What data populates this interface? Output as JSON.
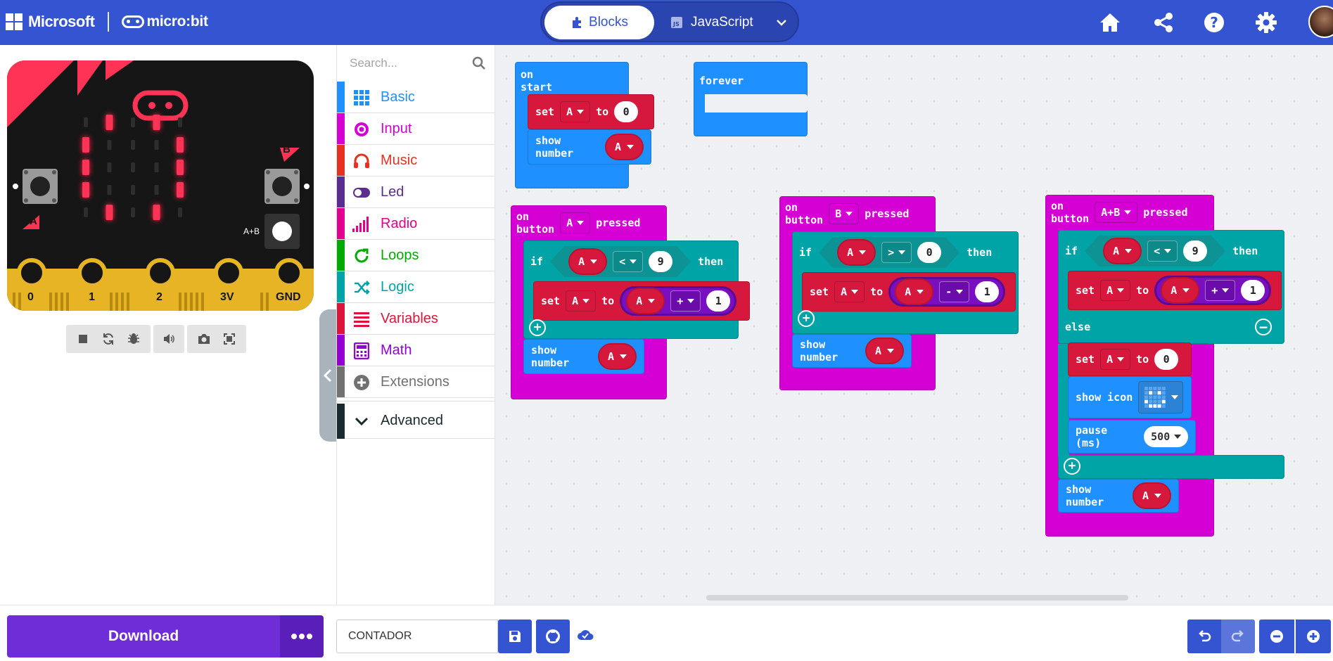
{
  "header": {
    "brand_microsoft": "Microsoft",
    "brand_microbit": "micro:bit",
    "tab_blocks": "Blocks",
    "tab_javascript": "JavaScript",
    "icons": [
      "home-icon",
      "share-icon",
      "help-icon",
      "settings-icon"
    ]
  },
  "simulator": {
    "pins": [
      "0",
      "1",
      "2",
      "3V",
      "GND"
    ],
    "button_a": "A",
    "button_b": "B",
    "button_ab": "A+B",
    "led_on": [
      [
        0,
        1,
        0,
        1,
        0
      ],
      [
        1,
        0,
        0,
        0,
        1
      ],
      [
        1,
        0,
        0,
        0,
        1
      ],
      [
        1,
        0,
        0,
        0,
        1
      ],
      [
        0,
        1,
        0,
        1,
        0
      ]
    ],
    "controls": [
      "stop-icon",
      "restart-icon",
      "debug-icon",
      "sound-icon",
      "screenshot-icon",
      "fullscreen-icon"
    ]
  },
  "toolbox": {
    "search_placeholder": "Search...",
    "categories": [
      {
        "label": "Basic",
        "color": "#1e90ff"
      },
      {
        "label": "Input",
        "color": "#d400d4"
      },
      {
        "label": "Music",
        "color": "#e63022"
      },
      {
        "label": "Led",
        "color": "#5c2d91"
      },
      {
        "label": "Radio",
        "color": "#e3008c"
      },
      {
        "label": "Loops",
        "color": "#00aa00"
      },
      {
        "label": "Logic",
        "color": "#00a4a6"
      },
      {
        "label": "Variables",
        "color": "#dc143c"
      },
      {
        "label": "Math",
        "color": "#9400d3"
      },
      {
        "label": "Extensions",
        "color": "#717171"
      }
    ],
    "advanced": "Advanced"
  },
  "blocks": {
    "on_start": {
      "title": "on start",
      "set": "set",
      "var": "A",
      "to": "to",
      "value": "0",
      "show_number": "show number"
    },
    "forever": {
      "title": "forever"
    },
    "btn_a": {
      "on_button": "on button",
      "button": "A",
      "pressed": "pressed",
      "if": "if",
      "var": "A",
      "op": "<",
      "cmp": "9",
      "then": "then",
      "set": "set",
      "to": "to",
      "math_op": "+",
      "delta": "1",
      "show_number": "show number"
    },
    "btn_b": {
      "on_button": "on button",
      "button": "B",
      "pressed": "pressed",
      "if": "if",
      "var": "A",
      "op": ">",
      "cmp": "0",
      "then": "then",
      "set": "set",
      "to": "to",
      "math_op": "-",
      "delta": "1",
      "show_number": "show number"
    },
    "btn_ab": {
      "on_button": "on button",
      "button": "A+B",
      "pressed": "pressed",
      "if": "if",
      "var": "A",
      "op": "<",
      "cmp": "9",
      "then": "then",
      "set": "set",
      "to": "to",
      "math_op": "+",
      "delta": "1",
      "else": "else",
      "reset": "0",
      "show_icon": "show icon",
      "pause": "pause (ms)",
      "pause_value": "500",
      "show_number": "show number"
    }
  },
  "footer": {
    "download": "Download",
    "project_name": "CONTADOR"
  }
}
